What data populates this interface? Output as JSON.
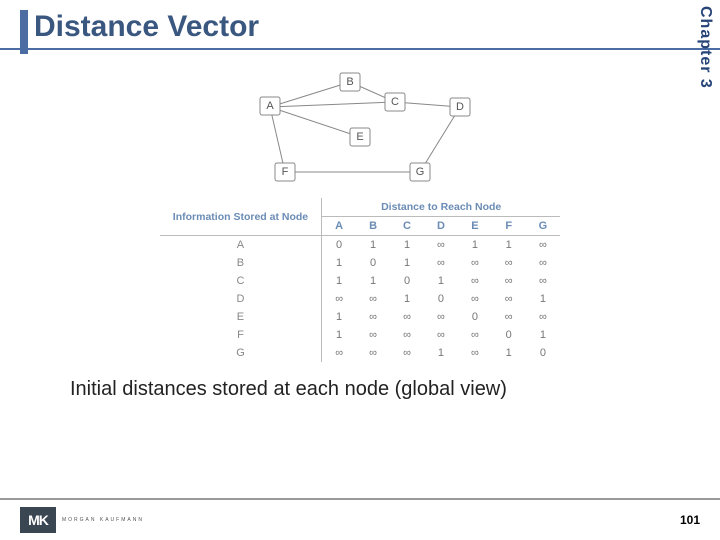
{
  "header": {
    "title": "Distance Vector",
    "chapter": "Chapter 3"
  },
  "graph": {
    "nodes": [
      "A",
      "B",
      "C",
      "D",
      "E",
      "F",
      "G"
    ]
  },
  "chart_data": {
    "type": "table",
    "title": "Distance to Reach Node",
    "row_header_label": "Information Stored at Node",
    "columns": [
      "A",
      "B",
      "C",
      "D",
      "E",
      "F",
      "G"
    ],
    "rows": [
      {
        "node": "A",
        "values": [
          "0",
          "1",
          "1",
          "∞",
          "1",
          "1",
          "∞"
        ]
      },
      {
        "node": "B",
        "values": [
          "1",
          "0",
          "1",
          "∞",
          "∞",
          "∞",
          "∞"
        ]
      },
      {
        "node": "C",
        "values": [
          "1",
          "1",
          "0",
          "1",
          "∞",
          "∞",
          "∞"
        ]
      },
      {
        "node": "D",
        "values": [
          "∞",
          "∞",
          "1",
          "0",
          "∞",
          "∞",
          "1"
        ]
      },
      {
        "node": "E",
        "values": [
          "1",
          "∞",
          "∞",
          "∞",
          "0",
          "∞",
          "∞"
        ]
      },
      {
        "node": "F",
        "values": [
          "1",
          "∞",
          "∞",
          "∞",
          "∞",
          "0",
          "1"
        ]
      },
      {
        "node": "G",
        "values": [
          "∞",
          "∞",
          "∞",
          "1",
          "∞",
          "1",
          "0"
        ]
      }
    ]
  },
  "caption": "Initial distances stored at each node (global view)",
  "footer": {
    "logo_mark": "MK",
    "logo_text": "MORGAN KAUFMANN",
    "page": "101"
  }
}
